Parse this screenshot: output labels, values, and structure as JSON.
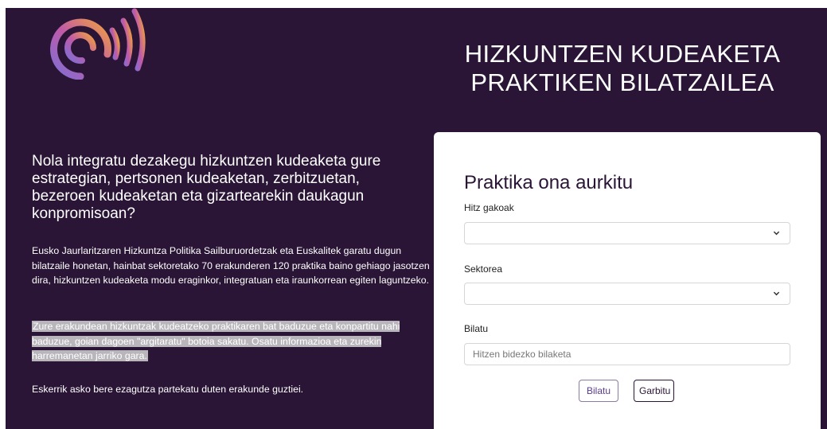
{
  "header": {
    "title_line1": "HIZKUNTZEN KUDEAKETA",
    "title_line2": "PRAKTIKEN BILATZAILEA",
    "logo_icon": "euskalit-signal-logo"
  },
  "intro": {
    "question": "Nola integratu dezakegu hizkuntzen kudeaketa gure estrategian, pertsonen kudeaketan, zerbitzuetan, bezeroen kudeaketan eta gizartearekin daukagun konpromisoan?",
    "paragraph1": "Eusko Jaurlaritzaren Hizkuntza Politika Sailburuordetzak eta Euskalitek garatu dugun bilatzaile honetan, hainbat sektoretako 70 erakunderen 120 praktika baino gehiago jasotzen dira, hizkuntzen kudeaketa modu eraginkor, integratuan eta iraunkorrean egiten laguntzeko.",
    "paragraph2": "Zure erakundean hizkuntzak kudeatzeko praktikaren bat baduzue eta konpartitu nahi baduzue, goian dagoen \"argitaratu\" botoia sakatu. Osatu informazioa eta zurekin harremanetan jarriko gara.",
    "paragraph3": "Eskerrik asko bere ezagutza partekatu duten erakunde guztiei."
  },
  "search_card": {
    "title": "Praktika ona aurkitu",
    "keywords_label": "Hitz gakoak",
    "keywords_value": "",
    "sector_label": "Sektorea",
    "sector_value": "",
    "search_label": "Bilatu",
    "search_placeholder": "Hitzen bidezko bilaketa",
    "search_button": "Bilatu",
    "clear_button": "Garbitu"
  },
  "colors": {
    "background": "#2a1536",
    "card": "#ffffff",
    "highlight": "#b9b6bb"
  }
}
